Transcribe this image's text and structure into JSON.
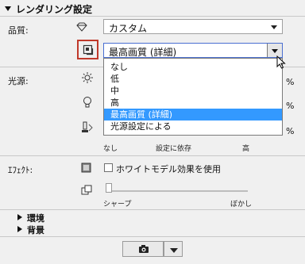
{
  "header": {
    "title": "レンダリング設定"
  },
  "quality": {
    "label": "品質:",
    "value": "カスタム",
    "preset_value": "最高画質 (詳細)",
    "options": [
      "なし",
      "低",
      "中",
      "高",
      "最高画質 (詳細)",
      "光源設定による"
    ],
    "selected_index": 4
  },
  "light": {
    "label": "光源:",
    "percent_unit": "%"
  },
  "shadow_slider": {
    "min_label": "なし",
    "mid_label": "設定に依存",
    "max_label": "高"
  },
  "effects": {
    "label": "ｴﾌｪｸﾄ:",
    "whitemodel_label": "ホワイトモデル効果を使用",
    "whitemodel_checked": false,
    "blur_min_label": "シャープ",
    "blur_max_label": "ぼかし"
  },
  "sections": {
    "environment": "環境",
    "background": "背景"
  },
  "colors": {
    "selection": "#3399ff",
    "highlight_box": "#c0392b"
  },
  "icons": {
    "quality": "diamond-icon",
    "preset": "render-preset-icon",
    "sun": "sun-icon",
    "bulb": "bulb-icon",
    "lamp": "lamp-icon",
    "effect": "square-icon",
    "blur": "copy-icon",
    "camera": "camera-icon"
  }
}
